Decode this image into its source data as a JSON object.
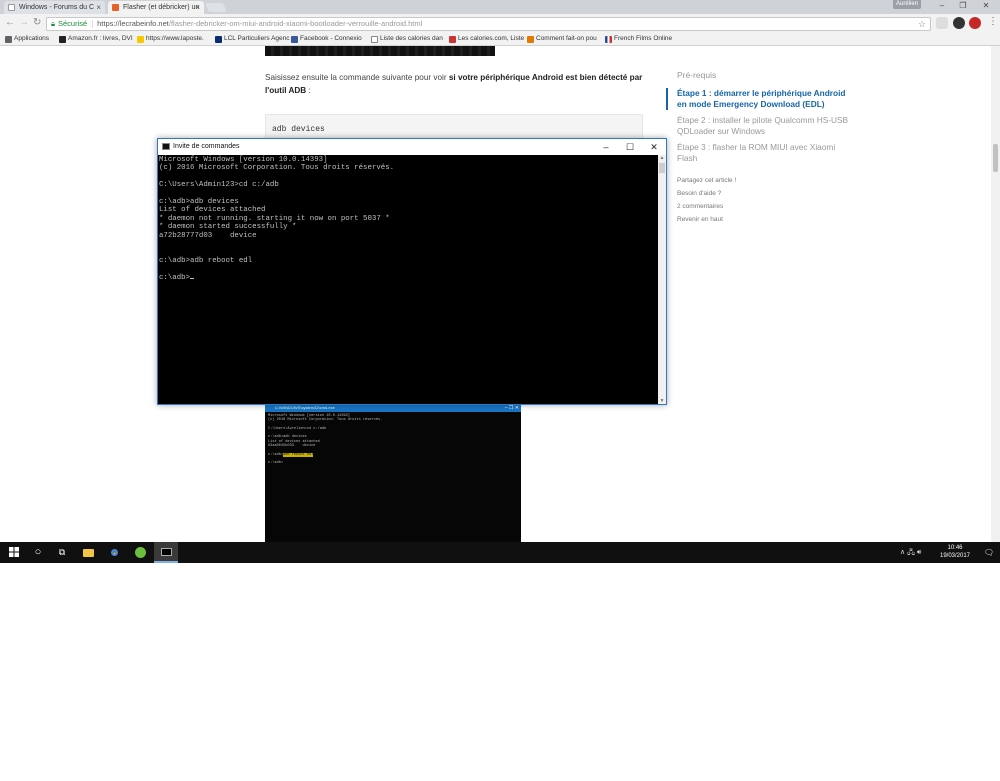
{
  "browser": {
    "tabs": [
      {
        "label": "Windows - Forums du C"
      },
      {
        "label": "Flasher (et débricker) un"
      }
    ],
    "user_badge": "Aurélien",
    "address": {
      "secure_label": "Sécurisé",
      "url_domain": "https://lecrabeinfo.net",
      "url_path": "/flasher-debricker-om-miui-android-xiaomi-bootloader-verrouille-android.html"
    },
    "bookmarks": [
      {
        "label": "Applications",
        "color": "#5f6368"
      },
      {
        "label": "Amazon.fr : livres, DVI",
        "color": "#222222"
      },
      {
        "label": "https://www.laposte.",
        "color": "#f5c800"
      },
      {
        "label": "LCL Particuliers Agenc",
        "color": "#0a2d6e"
      },
      {
        "label": "Facebook - Connexio",
        "color": "#3b5998"
      },
      {
        "label": "Liste des calories dan",
        "color": "#888888"
      },
      {
        "label": "Les calories.com, Liste",
        "color": "#cc3333"
      },
      {
        "label": "Comment fait-on pou",
        "color": "#e07b00"
      },
      {
        "label": "French Films Online",
        "color": "#2b4c9b"
      }
    ]
  },
  "page": {
    "intro_pre": "Saisissez ensuite la commande suivante pour voir ",
    "intro_bold": "si votre périphérique Android est bien détecté par l'outil ADB",
    "intro_post": " :",
    "code": "adb devices",
    "toc": {
      "title": "Pré-requis",
      "items": [
        {
          "label": "Étape 1 : démarrer le périphérique Android en mode Emergency Download (EDL)"
        },
        {
          "label": "Étape 2 : installer le pilote Qualcomm HS-USB QDLoader sur Windows"
        },
        {
          "label": "Étape 3 : flasher la ROM MIUI avec Xiaomi Flash"
        }
      ],
      "links": [
        {
          "label": "Partagez cet article !"
        },
        {
          "label": "Besoin d'aide ?"
        },
        {
          "label": "2 commentaires"
        },
        {
          "label": "Revenir en haut"
        }
      ]
    },
    "embedded": {
      "title": "C:\\WINDOWS\\system32\\cmd.exe",
      "lines_before": "Microsoft Windows [version 10.0.14393]\n(c) 2016 Microsoft Corporation. Tous droits réservés.\n\nC:\\Users\\Aurelien>cd c:/adb\n\nc:\\adb>adb devices\nList of devices attached\n63aa0045b033    device\n\n",
      "prompt": "c:\\adb>",
      "highlight": "adb reboot edl",
      "lines_after": "\n\nc:\\adb>"
    }
  },
  "cmd": {
    "title": "Invite de commandes",
    "output": "Microsoft Windows [version 10.0.14393]\n(c) 2016 Microsoft Corporation. Tous droits réservés.\n\nC:\\Users\\Admin123>cd c:/adb\n\nc:\\adb>adb devices\nList of devices attached\n* daemon not running. starting it now on port 5037 *\n* daemon started successfully *\na72b28777d03    device\n\n\nc:\\adb>adb reboot edl\n\nc:\\adb>"
  },
  "taskbar": {
    "time": "10:46",
    "date": "19/03/2017"
  }
}
